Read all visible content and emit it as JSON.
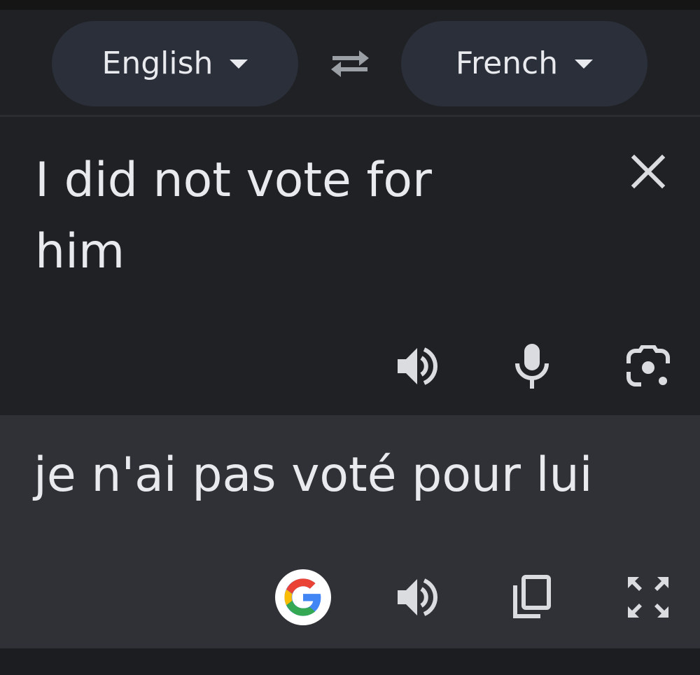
{
  "language_bar": {
    "source_language": "English",
    "target_language": "French"
  },
  "input": {
    "text": "I did not vote for him"
  },
  "output": {
    "text": "je n'ai pas voté pour lui"
  },
  "icons": {
    "swap": "swap-arrows-icon",
    "clear": "close-icon",
    "listen_source": "speaker-icon",
    "voice_input": "microphone-icon",
    "camera": "google-lens-icon",
    "google": "google-logo-icon",
    "listen_target": "speaker-icon",
    "copy": "copy-icon",
    "fullscreen": "fullscreen-icon"
  },
  "colors": {
    "background": "#202124",
    "output_background": "#303136",
    "pill": "#2a2f3a",
    "text": "#e8eaed",
    "icon": "#dadce0"
  }
}
